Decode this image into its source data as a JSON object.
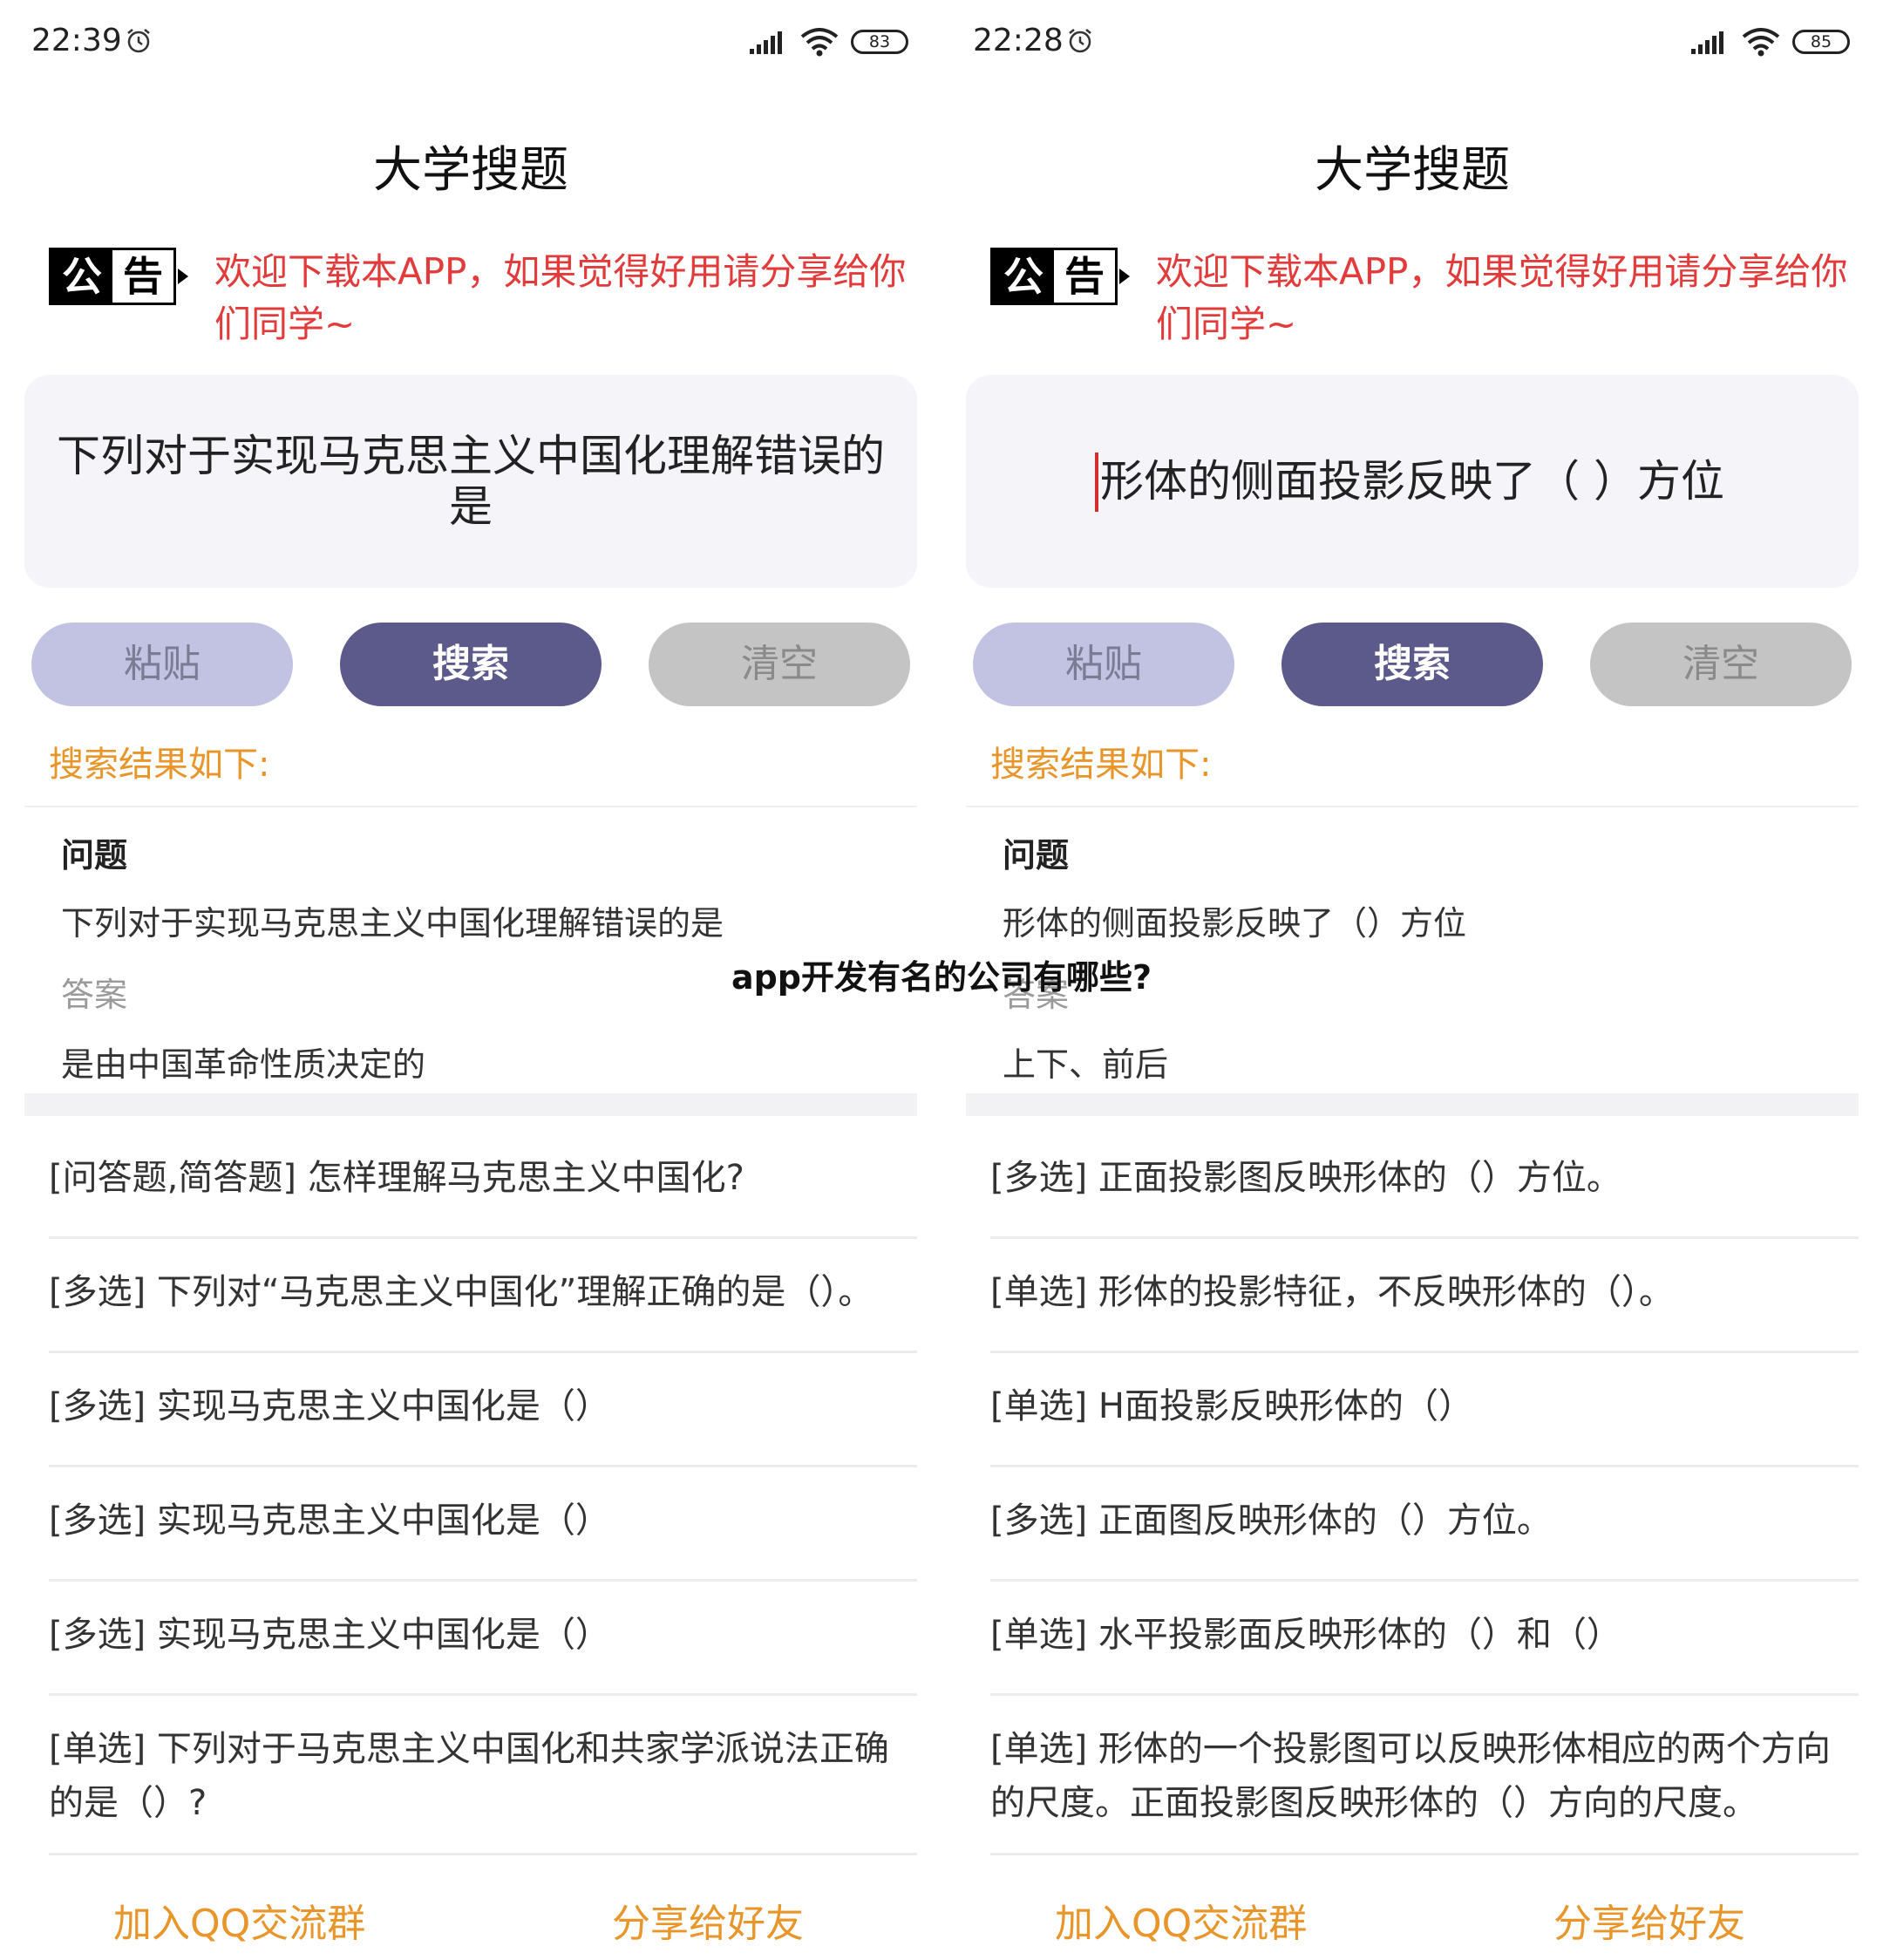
{
  "overlay_caption": "app开发有名的公司有哪些?",
  "colors": {
    "notice_red": "#e23b3b",
    "accent_orange": "#e8952a",
    "search_button": "#5b5a8a",
    "paste_button": "#c2c2e3",
    "clear_button": "#c4c4c4"
  },
  "screens": [
    {
      "status": {
        "time": "22:39",
        "battery": "83",
        "icons": [
          "alarm-icon",
          "signal-icon",
          "wifi-icon",
          "battery-icon"
        ]
      },
      "title": "大学搜题",
      "notice": {
        "badge_1": "公",
        "badge_2": "告",
        "text": "欢迎下载本APP，如果觉得好用请分享给你们同学~"
      },
      "query": "下列对于实现马克思主义中国化理解错误的是",
      "buttons": {
        "paste": "粘贴",
        "search": "搜索",
        "clear": "清空"
      },
      "results_heading": "搜索结果如下:",
      "result": {
        "question_label": "问题",
        "question": "下列对于实现马克思主义中国化理解错误的是",
        "answer_label": "答案",
        "answer": "是由中国革命性质决定的"
      },
      "related": [
        "[问答题,简答题] 怎样理解马克思主义中国化?",
        "[多选] 下列对“马克思主义中国化”理解正确的是（）。",
        "[多选] 实现马克思主义中国化是（）",
        "[多选] 实现马克思主义中国化是（）",
        "[多选] 实现马克思主义中国化是（）",
        "[单选] 下列对于马克思主义中国化和共家学派说法正确的是（）?"
      ],
      "footer": {
        "qq": "加入QQ交流群",
        "share": "分享给好友"
      }
    },
    {
      "status": {
        "time": "22:28",
        "battery": "85",
        "icons": [
          "alarm-icon",
          "signal-icon",
          "wifi-icon",
          "battery-icon"
        ]
      },
      "title": "大学搜题",
      "notice": {
        "badge_1": "公",
        "badge_2": "告",
        "text": "欢迎下载本APP，如果觉得好用请分享给你们同学~"
      },
      "query": "形体的侧面投影反映了（ ）方位",
      "buttons": {
        "paste": "粘贴",
        "search": "搜索",
        "clear": "清空"
      },
      "results_heading": "搜索结果如下:",
      "result": {
        "question_label": "问题",
        "question": "形体的侧面投影反映了（）方位",
        "answer_label": "答案",
        "answer": "上下、前后"
      },
      "related": [
        "[多选] 正面投影图反映形体的（）方位。",
        "[单选] 形体的投影特征，不反映形体的（）。",
        "[单选] H面投影反映形体的（）",
        "[多选] 正面图反映形体的（）方位。",
        "[单选] 水平投影面反映形体的（）和（）",
        "[单选] 形体的一个投影图可以反映形体相应的两个方向的尺度。正面投影图反映形体的（）方向的尺度。"
      ],
      "footer": {
        "qq": "加入QQ交流群",
        "share": "分享给好友"
      }
    }
  ]
}
